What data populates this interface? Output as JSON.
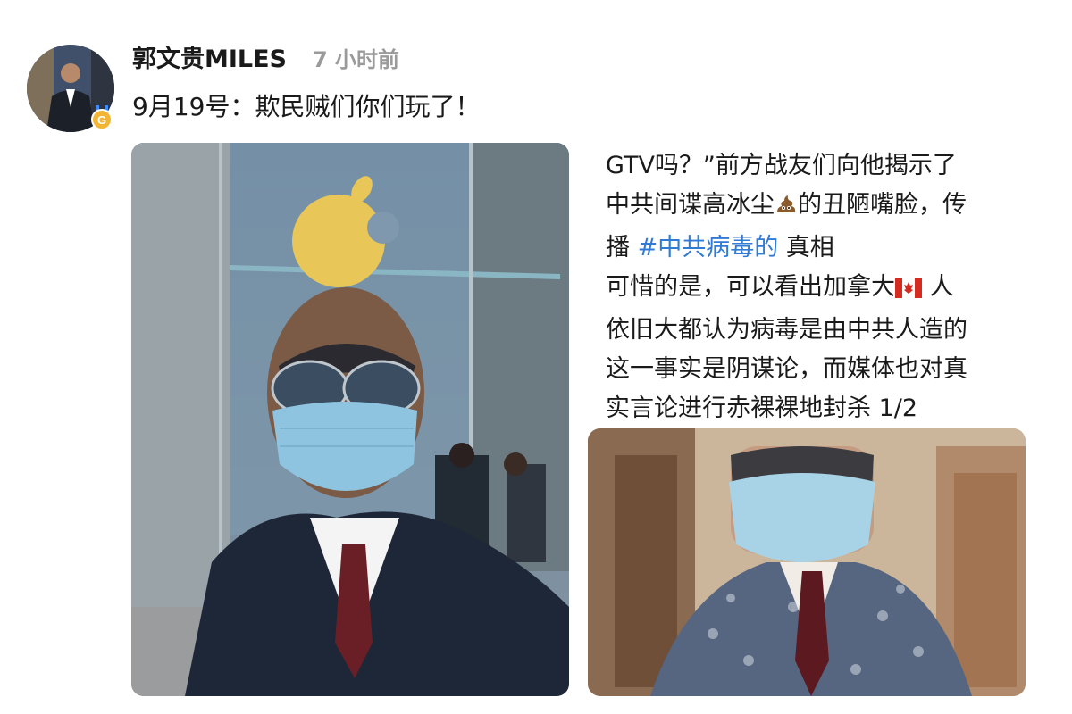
{
  "post": {
    "author": "郭文贵MILES",
    "time": "7 小时前",
    "text": "9月19号：欺民贼们你们玩了！"
  },
  "caption": {
    "line1": "GTV吗？”前方战友们向他揭示了",
    "line2_a": "中共间谍高冰尘",
    "line2_emoji": "pile-of-poo-icon",
    "line2_b": "的丑陋嘴脸，传",
    "line3_a": "播 ",
    "hashtag": "#中共病毒的",
    "line3_b": " 真相",
    "line4_a": "可惜的是，可以看出加拿大",
    "line4_emoji": "canada-flag-icon",
    "line4_b": " 人",
    "line5": "依旧大都认为病毒是由中共人造的",
    "line6": "这一事实是阴谋论，而媒体也对真",
    "line7": "实言论进行赤裸裸地封杀 1/2"
  },
  "colors": {
    "hashtag": "#2f7bd6",
    "time": "#9a9a9a",
    "badge_blue": "#3d8bfd",
    "badge_gold": "#f2b634"
  }
}
